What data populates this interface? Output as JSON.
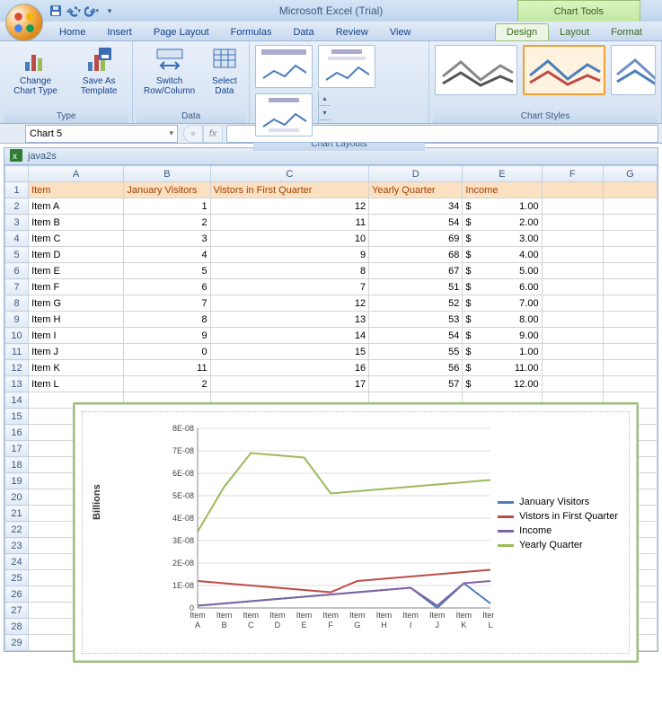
{
  "app_title": "Microsoft Excel (Trial)",
  "chart_tools_label": "Chart Tools",
  "tabs": {
    "home": "Home",
    "insert": "Insert",
    "page_layout": "Page Layout",
    "formulas": "Formulas",
    "data": "Data",
    "review": "Review",
    "view": "View",
    "design": "Design",
    "layout": "Layout",
    "format": "Format"
  },
  "ribbon": {
    "type_group": "Type",
    "change_chart_type": "Change\nChart Type",
    "save_as_template": "Save As\nTemplate",
    "data_group": "Data",
    "switch": "Switch\nRow/Column",
    "select_data": "Select\nData",
    "layouts_group": "Chart Layouts",
    "styles_group": "Chart Styles"
  },
  "namebox": "Chart 5",
  "fx_label": "fx",
  "book": "java2s",
  "columns": [
    "A",
    "B",
    "C",
    "D",
    "E",
    "F",
    "G"
  ],
  "headers": {
    "A": "Item",
    "B": "January Visitors",
    "C": "Vistors in First Quarter",
    "D": "Yearly Quarter",
    "E": "Income"
  },
  "rows": [
    {
      "n": 1,
      "hdr": true
    },
    {
      "n": 2,
      "A": "Item A",
      "B": "1",
      "C": "12",
      "D": "34",
      "E": "1.00"
    },
    {
      "n": 3,
      "A": "Item B",
      "B": "2",
      "C": "11",
      "D": "54",
      "E": "2.00"
    },
    {
      "n": 4,
      "A": "Item C",
      "B": "3",
      "C": "10",
      "D": "69",
      "E": "3.00"
    },
    {
      "n": 5,
      "A": "Item D",
      "B": "4",
      "C": "9",
      "D": "68",
      "E": "4.00"
    },
    {
      "n": 6,
      "A": "Item E",
      "B": "5",
      "C": "8",
      "D": "67",
      "E": "5.00"
    },
    {
      "n": 7,
      "A": "Item F",
      "B": "6",
      "C": "7",
      "D": "51",
      "E": "6.00"
    },
    {
      "n": 8,
      "A": "Item G",
      "B": "7",
      "C": "12",
      "D": "52",
      "E": "7.00"
    },
    {
      "n": 9,
      "A": "Item H",
      "B": "8",
      "C": "13",
      "D": "53",
      "E": "8.00"
    },
    {
      "n": 10,
      "A": "Item I",
      "B": "9",
      "C": "14",
      "D": "54",
      "E": "9.00"
    },
    {
      "n": 11,
      "A": "Item J",
      "B": "0",
      "C": "15",
      "D": "55",
      "E": "1.00"
    },
    {
      "n": 12,
      "A": "Item K",
      "B": "11",
      "C": "16",
      "D": "56",
      "E": "11.00"
    },
    {
      "n": 13,
      "A": "Item L",
      "B": "2",
      "C": "17",
      "D": "57",
      "E": "12.00"
    },
    {
      "n": 14
    },
    {
      "n": 15
    },
    {
      "n": 16
    },
    {
      "n": 17
    },
    {
      "n": 18
    },
    {
      "n": 19
    },
    {
      "n": 20
    },
    {
      "n": 21
    },
    {
      "n": 22
    },
    {
      "n": 23
    },
    {
      "n": 24
    },
    {
      "n": 25
    },
    {
      "n": 26
    },
    {
      "n": 27
    },
    {
      "n": 28
    },
    {
      "n": 29
    }
  ],
  "chart_data": {
    "type": "line",
    "ylabel": "Billions",
    "ylim": [
      0,
      8e-08
    ],
    "yticks": [
      "0",
      "1E-08",
      "2E-08",
      "3E-08",
      "4E-08",
      "5E-08",
      "6E-08",
      "7E-08",
      "8E-08"
    ],
    "categories": [
      "Item A",
      "Item B",
      "Item C",
      "Item D",
      "Item E",
      "Item F",
      "Item G",
      "Item H",
      "Item I",
      "Item J",
      "Item K",
      "Item L"
    ],
    "series": [
      {
        "name": "January Visitors",
        "color": "#4a7ebb",
        "values": [
          1,
          2,
          3,
          4,
          5,
          6,
          7,
          8,
          9,
          0,
          11,
          2
        ]
      },
      {
        "name": "Vistors in First Quarter",
        "color": "#be4b48",
        "values": [
          12,
          11,
          10,
          9,
          8,
          7,
          12,
          13,
          14,
          15,
          16,
          17
        ]
      },
      {
        "name": "Income",
        "color": "#8064a2",
        "values": [
          1,
          2,
          3,
          4,
          5,
          6,
          7,
          8,
          9,
          1,
          11,
          12
        ]
      },
      {
        "name": "Yearly Quarter",
        "color": "#9bbb59",
        "values": [
          34,
          54,
          69,
          68,
          67,
          51,
          52,
          53,
          54,
          55,
          56,
          57
        ]
      }
    ]
  }
}
